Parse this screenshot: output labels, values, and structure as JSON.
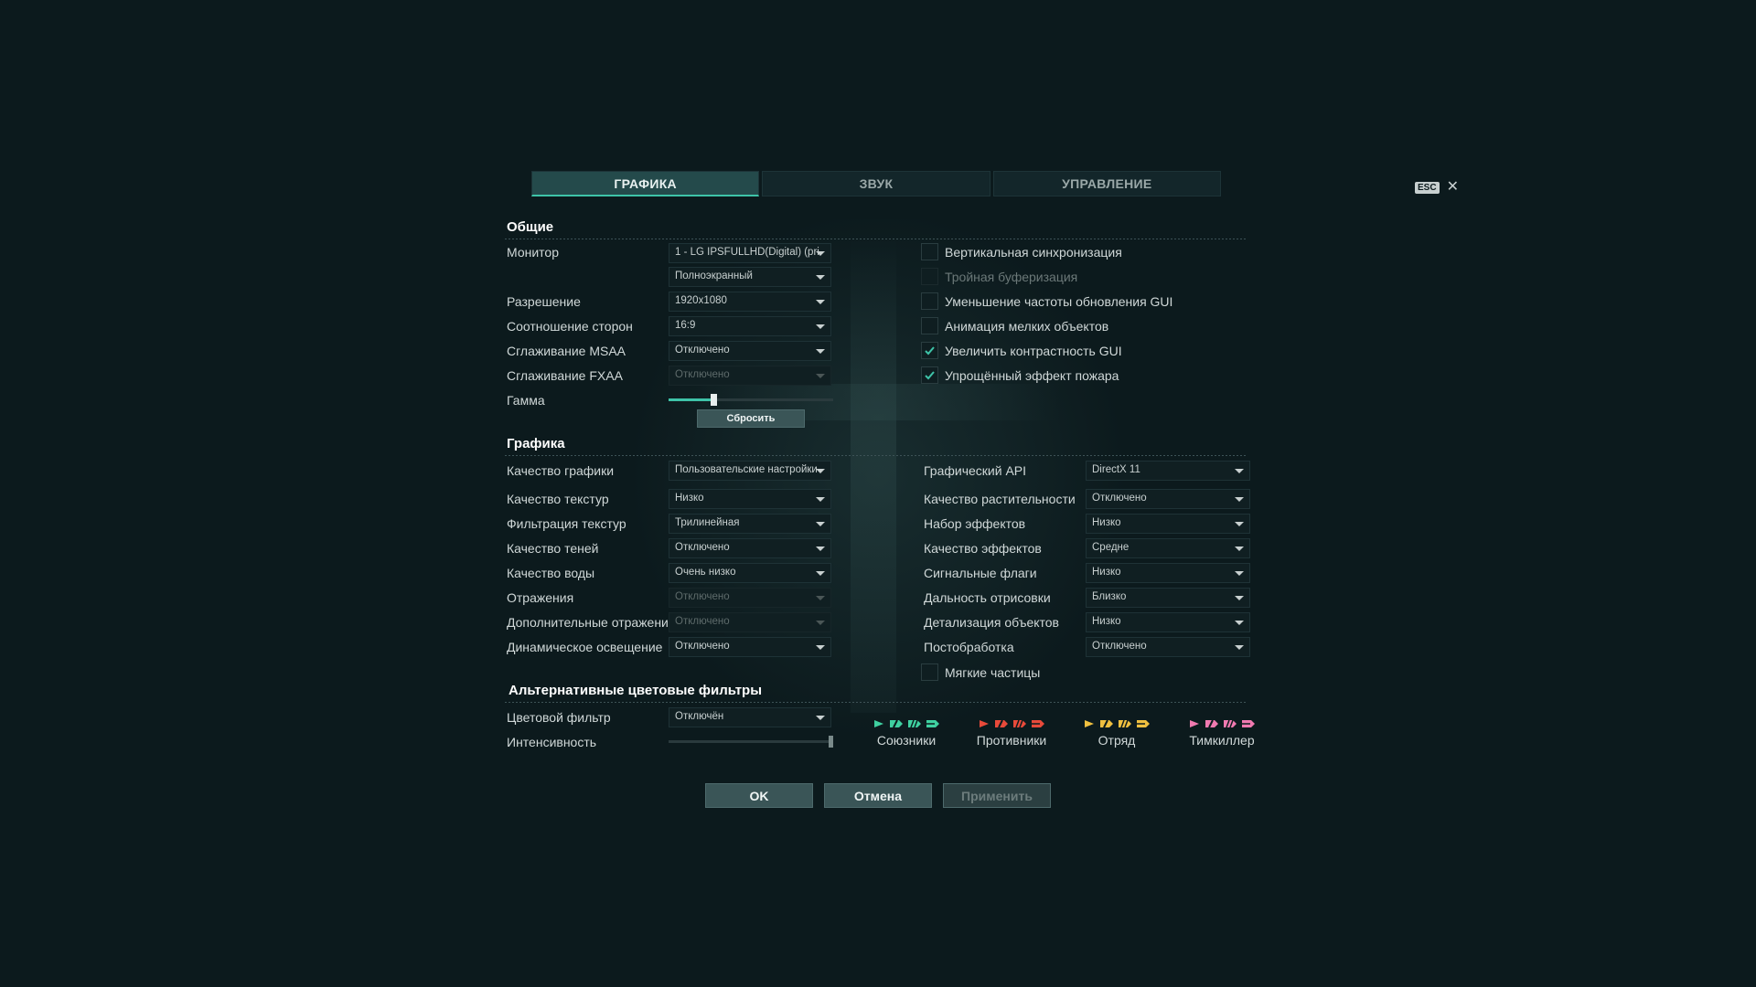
{
  "tabs": [
    {
      "label": "ГРАФИКА",
      "active": true
    },
    {
      "label": "ЗВУК",
      "active": false
    },
    {
      "label": "УПРАВЛЕНИЕ",
      "active": false
    }
  ],
  "esc": {
    "key": "ESC",
    "close": "✕"
  },
  "general": {
    "title": "Общие",
    "monitor_label": "Монитор",
    "monitor_value": "1 - LG IPSFULLHD(Digital) (pri",
    "mode_value": "Полноэкранный",
    "resolution_label": "Разрешение",
    "resolution_value": "1920x1080",
    "aspect_label": "Соотношение сторон",
    "aspect_value": "16:9",
    "msaa_label": "Сглаживание MSAA",
    "msaa_value": "Отключено",
    "fxaa_label": "Сглаживание FXAA",
    "fxaa_value": "Отключено",
    "gamma_label": "Гамма",
    "gamma_level": 0.27,
    "reset_label": "Сбросить",
    "checks": [
      {
        "label": "Вертикальная синхронизация",
        "checked": false,
        "disabled": false
      },
      {
        "label": "Тройная буферизация",
        "checked": false,
        "disabled": true
      },
      {
        "label": "Уменьшение частоты обновления GUI",
        "checked": false,
        "disabled": false
      },
      {
        "label": "Анимация мелких объектов",
        "checked": false,
        "disabled": false
      },
      {
        "label": "Увеличить контрастность GUI",
        "checked": true,
        "disabled": false
      },
      {
        "label": "Упрощённый эффект пожара",
        "checked": true,
        "disabled": false
      }
    ]
  },
  "graphics": {
    "title": "Графика",
    "left": [
      {
        "label": "Качество графики",
        "value": "Пользовательские настройки",
        "disabled": false
      },
      {
        "label": "Качество текстур",
        "value": "Низко",
        "disabled": false
      },
      {
        "label": "Фильтрация текстур",
        "value": "Трилинейная",
        "disabled": false
      },
      {
        "label": "Качество теней",
        "value": "Отключено",
        "disabled": false
      },
      {
        "label": "Качество воды",
        "value": "Очень низко",
        "disabled": false
      },
      {
        "label": "Отражения",
        "value": "Отключено",
        "disabled": true
      },
      {
        "label": "Дополнительные отражения",
        "value": "Отключено",
        "disabled": true
      },
      {
        "label": "Динамическое освещение",
        "value": "Отключено",
        "disabled": false
      }
    ],
    "right": [
      {
        "label": "Графический API",
        "value": "DirectX 11"
      },
      {
        "label": "Качество растительности",
        "value": "Отключено"
      },
      {
        "label": "Набор эффектов",
        "value": "Низко"
      },
      {
        "label": "Качество эффектов",
        "value": "Средне"
      },
      {
        "label": "Сигнальные флаги",
        "value": "Низко"
      },
      {
        "label": "Дальность отрисовки",
        "value": "Близко"
      },
      {
        "label": "Детализация объектов",
        "value": "Низко"
      },
      {
        "label": "Постобработка",
        "value": "Отключено"
      }
    ],
    "soft_particles_label": "Мягкие частицы",
    "soft_particles_checked": false
  },
  "filters": {
    "title": "Альтернативные цветовые фильтры",
    "color_filter_label": "Цветовой фильтр",
    "color_filter_value": "Отключён",
    "intensity_label": "Интенсивность",
    "intensity_level": 1.0,
    "groups": [
      {
        "name": "Союзники",
        "color": "#3fd0a0"
      },
      {
        "name": "Противники",
        "color": "#e84a3a"
      },
      {
        "name": "Отряд",
        "color": "#f0c040"
      },
      {
        "name": "Тимкиллер",
        "color": "#f07ab0"
      }
    ]
  },
  "buttons": {
    "ok": "OK",
    "cancel": "Отмена",
    "apply": "Применить"
  },
  "colors": {
    "accent": "#3ec3a8",
    "background": "#0c1a1d"
  }
}
